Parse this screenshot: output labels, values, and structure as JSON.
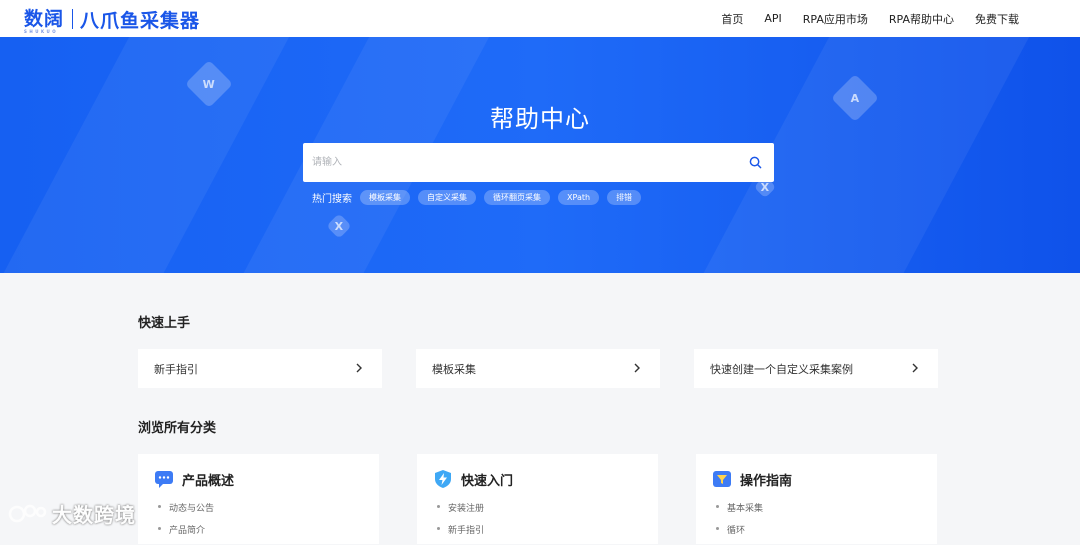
{
  "header": {
    "logo_brand": "数阔",
    "logo_sub": "SHUKUO",
    "logo_product": "八爪鱼采集器",
    "nav": [
      "首页",
      "API",
      "RPA应用市场",
      "RPA帮助中心",
      "免费下载"
    ]
  },
  "hero": {
    "title": "帮助中心",
    "search_placeholder": "请输入",
    "hot_label": "热门搜索",
    "hot_tags": [
      "模板采集",
      "自定义采集",
      "循环翻页采集",
      "XPath",
      "排错"
    ]
  },
  "quick_start": {
    "title": "快速上手",
    "items": [
      "新手指引",
      "模板采集",
      "快速创建一个自定义采集案例"
    ]
  },
  "browse": {
    "title": "浏览所有分类",
    "categories": [
      {
        "title": "产品概述",
        "items": [
          "动态与公告",
          "产品简介"
        ]
      },
      {
        "title": "快速入门",
        "items": [
          "安装注册",
          "新手指引"
        ]
      },
      {
        "title": "操作指南",
        "items": [
          "基本采集",
          "循环"
        ]
      }
    ]
  },
  "watermark": "大数跨境",
  "colors": {
    "brand": "#1a56e8",
    "hero": "#1f6bf8",
    "page_bg": "#f5f6f8"
  }
}
